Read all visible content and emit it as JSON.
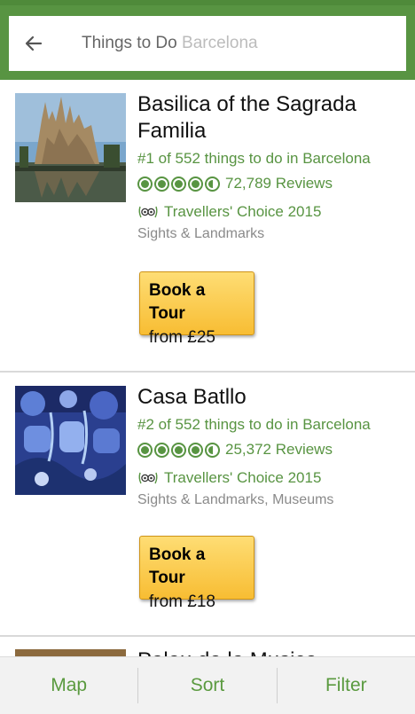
{
  "search": {
    "prefix": "Things to Do",
    "placeholder": "Barcelona"
  },
  "results": [
    {
      "title_line1": "Basilica of the Sagrada",
      "title_line2": "Familia",
      "rank": "#1 of 552 things to do in Barcelona",
      "rating": 4.5,
      "reviews": "72,789 Reviews",
      "award": "Travellers' Choice 2015",
      "category": "Sights & Landmarks",
      "book_line1": "Book a Tour",
      "book_line2": "from £25"
    },
    {
      "title_line1": "Casa Batllo",
      "rank": "#2 of 552 things to do in Barcelona",
      "rating": 4.5,
      "reviews": "25,372 Reviews",
      "award": "Travellers' Choice 2015",
      "category": "Sights & Landmarks, Museums",
      "book_line1": "Book a Tour",
      "book_line2": "from £18"
    },
    {
      "title_line1": "Palau de la Musica Catalana"
    }
  ],
  "tabs": [
    "Map",
    "Sort",
    "Filter"
  ],
  "colors": {
    "brand_green": "#589442",
    "button_yellow": "#f8bd33"
  },
  "icons": {
    "back": "arrow-back-icon",
    "rating": "rating-bubbles-icon",
    "award": "owl-award-icon"
  }
}
